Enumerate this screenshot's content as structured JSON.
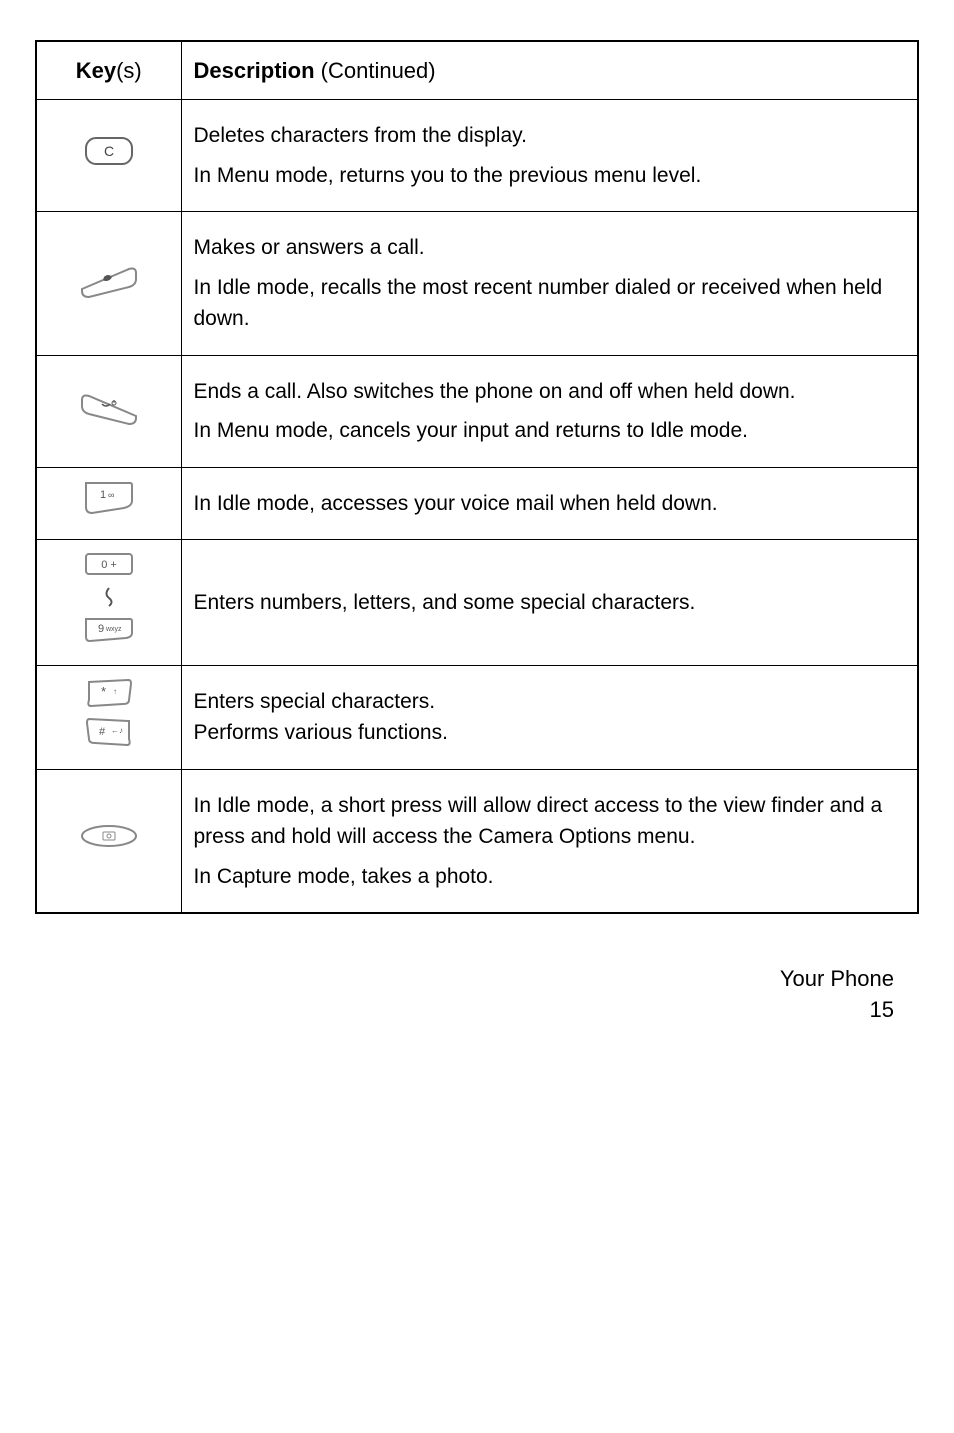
{
  "header": {
    "key_col_prefix": "Key",
    "key_col_suffix": "(s)",
    "desc_col_prefix": "Description",
    "desc_col_suffix": "  (Continued)"
  },
  "rows": {
    "r1": {
      "p1": "Deletes characters from the display.",
      "p2": "In Menu mode, returns you to the previous menu level."
    },
    "r2": {
      "p1": "Makes or answers a call.",
      "p2": "In Idle mode, recalls the most recent number dialed or received when held down."
    },
    "r3": {
      "p1": "Ends a call. Also switches the phone on and off when held down.",
      "p2": "In Menu mode, cancels your input and returns to Idle mode."
    },
    "r4": {
      "p1": "In Idle mode, accesses your voice mail when held down."
    },
    "r5": {
      "p1": "Enters numbers, letters, and some special characters."
    },
    "r6": {
      "p1": "Enters special characters.",
      "p2": "Performs various functions."
    },
    "r7": {
      "p1": "In Idle mode, a short press will allow direct access to the view finder and a press and hold will access the Camera Options menu.",
      "p2": "In Capture mode, takes a photo."
    }
  },
  "footer": {
    "section": "Your Phone",
    "page": "15"
  }
}
